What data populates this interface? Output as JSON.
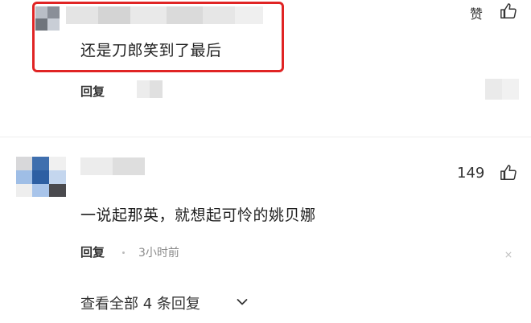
{
  "colors": {
    "highlight_border": "#e02424",
    "text_primary": "#1f1f1f",
    "text_meta": "#8a8a8a"
  },
  "comments": [
    {
      "text": "还是刀郎笑到了最后",
      "reply_label": "回复",
      "like_label": "赞",
      "like_icon": "thumbs-up-icon"
    },
    {
      "text": "一说起那英，就想起可怜的姚贝娜",
      "reply_label": "回复",
      "time": "3小时前",
      "like_count": "149",
      "like_icon": "thumbs-up-icon",
      "close_icon": "close-icon"
    }
  ],
  "view_more": {
    "label": "查看全部 4 条回复",
    "icon": "chevron-down-icon"
  }
}
